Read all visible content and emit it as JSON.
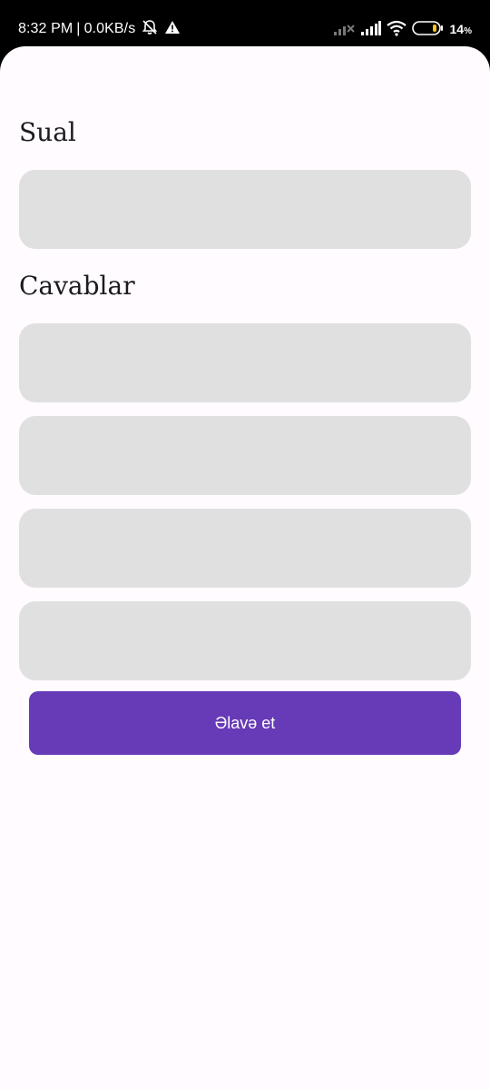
{
  "status_bar": {
    "time": "8:32 PM",
    "separator": "|",
    "network_speed": "0.0KB/s",
    "battery_level": "14",
    "battery_unit": "%",
    "icons": [
      "bell-muted-icon",
      "warning-icon",
      "signal-no-sim-icon",
      "signal-icon",
      "wifi-icon",
      "battery-icon"
    ]
  },
  "form": {
    "question_label": "Sual",
    "question_value": "",
    "answers_label": "Cavablar",
    "answers": [
      "",
      "",
      "",
      ""
    ],
    "submit_label": "Əlavə et"
  },
  "colors": {
    "background": "#fffbfe",
    "field": "#e0e0e0",
    "accent": "#673ab7",
    "text": "#1c1b1f"
  }
}
